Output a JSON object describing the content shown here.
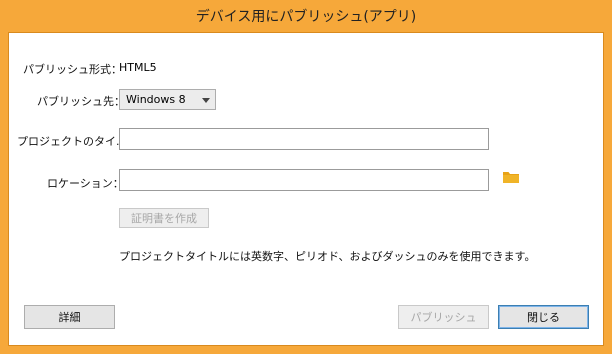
{
  "window": {
    "title": "デバイス用にパブリッシュ(アプリ)"
  },
  "form": {
    "format_label": "パブリッシュ形式：",
    "format_value": "HTML5",
    "target_label": "パブリッシュ先：",
    "target_value": "Windows 8",
    "project_title_label": "プロジェクトのタイ...",
    "project_title_value": "",
    "location_label": "ロケーション：",
    "location_value": "",
    "certificate_button": "証明書を作成",
    "info_text": "プロジェクトタイトルには英数字、ピリオド、およびダッシュのみを使用できます。"
  },
  "buttons": {
    "details": "詳細",
    "publish": "パブリッシュ",
    "close": "閉じる"
  },
  "colors": {
    "frame": "#f6a83a",
    "folder_icon": "#e8a317"
  },
  "icons": {
    "location_browse": "folder-icon",
    "dropdown": "chevron-down-icon"
  }
}
